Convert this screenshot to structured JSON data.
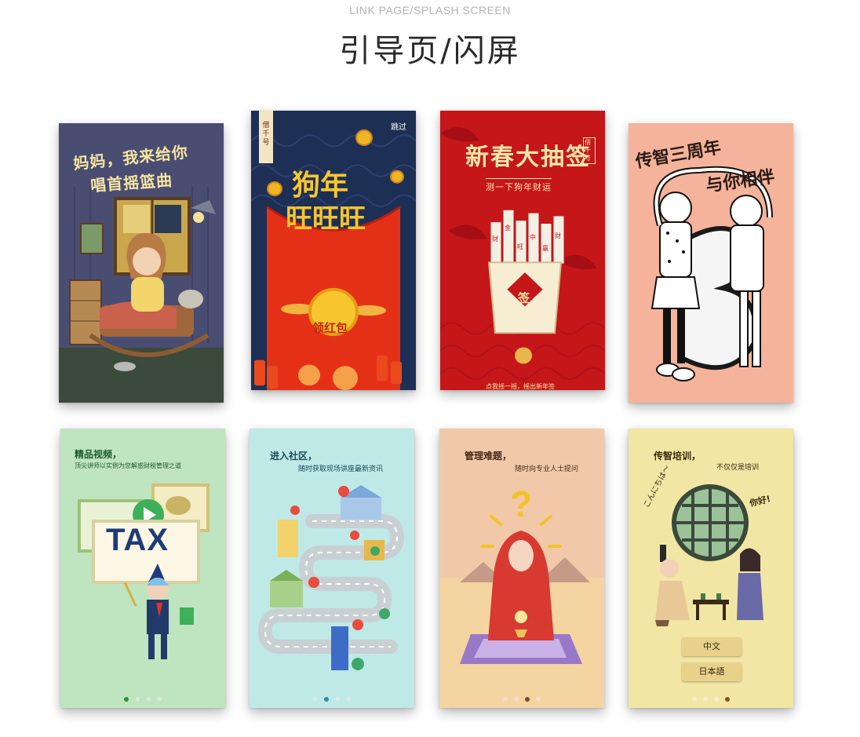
{
  "header": {
    "subtitle": "LINK PAGE/SPLASH SCREEN",
    "title": "引导页/闪屏"
  },
  "cards": {
    "grandma": {
      "line1": "妈妈，我来给你",
      "line2": "唱首摇篮曲"
    },
    "redpacket": {
      "skip": "跳过",
      "brand": "借千号",
      "headline1": "狗年",
      "headline2": "旺旺旺",
      "button": "领红包"
    },
    "lottery": {
      "title": "新春大抽签",
      "tagline": "测一下狗年财运",
      "brand": "借千号",
      "sticks": [
        "财",
        "金",
        "旺",
        "中",
        "赢",
        "财"
      ],
      "seal": "签",
      "hint": "点我摇一摇，摇出新年签"
    },
    "anniversary": {
      "line1": "传智三周年",
      "line2": "与你相伴"
    },
    "tax": {
      "heading": "精品视频，",
      "sub": "顶尖讲师以实例为您解惑财税管理之道",
      "board": "TAX",
      "dots_active": 0
    },
    "community": {
      "heading": "进入社区，",
      "sub": "随时获取现场讲座最新资讯",
      "dots_active": 1
    },
    "problems": {
      "heading": "管理难题，",
      "sub": "随时向专业人士提问",
      "dots_active": 2
    },
    "training": {
      "heading": "传智培训，",
      "heading2": "不仅仅是培训",
      "bubble_left": "こんにちは～",
      "bubble_right": "你好!",
      "buttons": [
        "中文",
        "日本語"
      ],
      "dots_active": 3
    }
  },
  "colors": {
    "red": "#c5161a",
    "gold": "#f3c623",
    "mint": "#bfe4c0",
    "cyan": "#bfe9e6",
    "peach": "#f1c9a8",
    "cream": "#f2e6a4"
  }
}
